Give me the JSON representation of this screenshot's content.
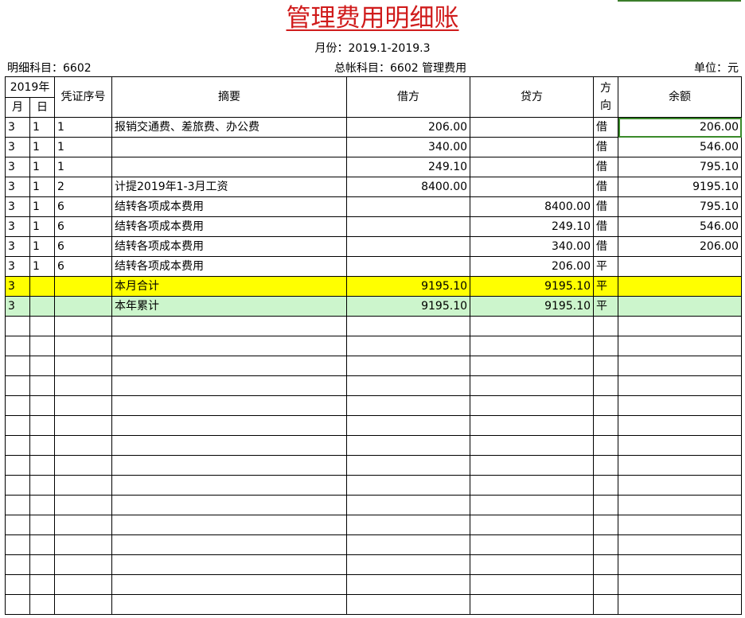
{
  "title": "管理费用明细账",
  "month_label": "月份：2019.1-2019.3",
  "detail_account": "明细科目：6602",
  "general_account": "总帐科目：6602  管理费用",
  "unit": "单位：元",
  "headers": {
    "year": "2019年",
    "month": "月",
    "day": "日",
    "voucher": "凭证序号",
    "summary": "摘要",
    "debit": "借方",
    "credit": "贷方",
    "direction_top": "方",
    "direction_bottom": "向",
    "balance": "余额"
  },
  "rows": [
    {
      "month": "3",
      "day": "1",
      "voucher": "1",
      "summary": "报销交通费、差旅费、办公费",
      "debit": "206.00",
      "credit": "",
      "direction": "借",
      "balance": "206.00"
    },
    {
      "month": "3",
      "day": "1",
      "voucher": "1",
      "summary": "",
      "debit": "340.00",
      "credit": "",
      "direction": "借",
      "balance": "546.00"
    },
    {
      "month": "3",
      "day": "1",
      "voucher": "1",
      "summary": "",
      "debit": "249.10",
      "credit": "",
      "direction": "借",
      "balance": "795.10"
    },
    {
      "month": "3",
      "day": "1",
      "voucher": "2",
      "summary": "计提2019年1-3月工资",
      "debit": "8400.00",
      "credit": "",
      "direction": "借",
      "balance": "9195.10"
    },
    {
      "month": "3",
      "day": "1",
      "voucher": "6",
      "summary": "结转各项成本费用",
      "debit": "",
      "credit": "8400.00",
      "direction": "借",
      "balance": "795.10"
    },
    {
      "month": "3",
      "day": "1",
      "voucher": "6",
      "summary": "结转各项成本费用",
      "debit": "",
      "credit": "249.10",
      "direction": "借",
      "balance": "546.00"
    },
    {
      "month": "3",
      "day": "1",
      "voucher": "6",
      "summary": "结转各项成本费用",
      "debit": "",
      "credit": "340.00",
      "direction": "借",
      "balance": "206.00"
    },
    {
      "month": "3",
      "day": "1",
      "voucher": "6",
      "summary": "结转各项成本费用",
      "debit": "",
      "credit": "206.00",
      "direction": "平",
      "balance": ""
    },
    {
      "month": "3",
      "day": "",
      "voucher": "",
      "summary": "本月合计",
      "debit": "9195.10",
      "credit": "9195.10",
      "direction": "平",
      "balance": ""
    },
    {
      "month": "3",
      "day": "",
      "voucher": "",
      "summary": "本年累计",
      "debit": "9195.10",
      "credit": "9195.10",
      "direction": "平",
      "balance": ""
    }
  ],
  "empty_rows": 15
}
